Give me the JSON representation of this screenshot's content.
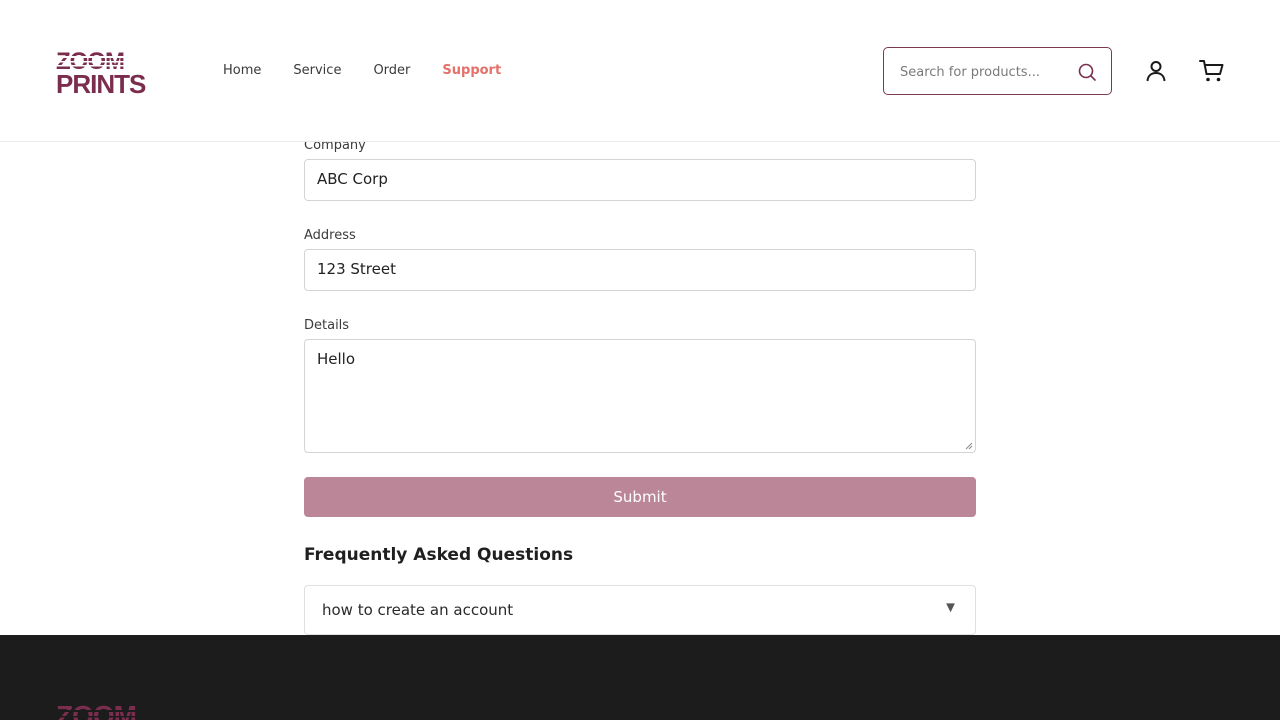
{
  "header": {
    "logo": {
      "line1": "ZOOM",
      "line2": "PRINTS",
      "brand_color": "#7b2d4e"
    },
    "nav": [
      {
        "label": "Home",
        "active": false
      },
      {
        "label": "Service",
        "active": false
      },
      {
        "label": "Order",
        "active": false
      },
      {
        "label": "Support",
        "active": true
      }
    ],
    "search": {
      "placeholder": "Search for products...",
      "value": "",
      "icon": "search-icon"
    },
    "icons": [
      "user-icon",
      "cart-icon"
    ],
    "accent_color": "#e5716a"
  },
  "form": {
    "company": {
      "label": "Company",
      "value": "ABC Corp"
    },
    "address": {
      "label": "Address",
      "value": "123 Street"
    },
    "details": {
      "label": "Details",
      "value": "Hello"
    },
    "submit_label": "Submit",
    "submit_color": "#bb8698"
  },
  "faq": {
    "title": "Frequently Asked Questions",
    "items": [
      {
        "question": "how to create an account",
        "icon": "triangle-down-icon"
      }
    ]
  },
  "footer": {
    "background": "#1c1c1c"
  }
}
